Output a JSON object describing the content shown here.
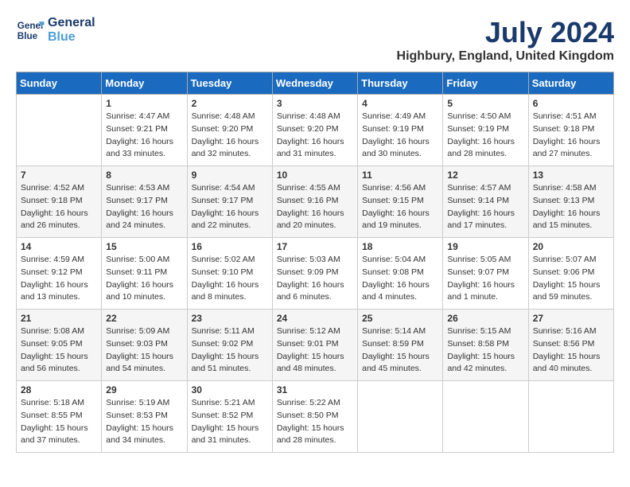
{
  "logo": {
    "line1": "General",
    "line2": "Blue"
  },
  "title": "July 2024",
  "location": "Highbury, England, United Kingdom",
  "days_of_week": [
    "Sunday",
    "Monday",
    "Tuesday",
    "Wednesday",
    "Thursday",
    "Friday",
    "Saturday"
  ],
  "weeks": [
    [
      {
        "day": "",
        "sunrise": "",
        "sunset": "",
        "daylight": ""
      },
      {
        "day": "1",
        "sunrise": "Sunrise: 4:47 AM",
        "sunset": "Sunset: 9:21 PM",
        "daylight": "Daylight: 16 hours and 33 minutes."
      },
      {
        "day": "2",
        "sunrise": "Sunrise: 4:48 AM",
        "sunset": "Sunset: 9:20 PM",
        "daylight": "Daylight: 16 hours and 32 minutes."
      },
      {
        "day": "3",
        "sunrise": "Sunrise: 4:48 AM",
        "sunset": "Sunset: 9:20 PM",
        "daylight": "Daylight: 16 hours and 31 minutes."
      },
      {
        "day": "4",
        "sunrise": "Sunrise: 4:49 AM",
        "sunset": "Sunset: 9:19 PM",
        "daylight": "Daylight: 16 hours and 30 minutes."
      },
      {
        "day": "5",
        "sunrise": "Sunrise: 4:50 AM",
        "sunset": "Sunset: 9:19 PM",
        "daylight": "Daylight: 16 hours and 28 minutes."
      },
      {
        "day": "6",
        "sunrise": "Sunrise: 4:51 AM",
        "sunset": "Sunset: 9:18 PM",
        "daylight": "Daylight: 16 hours and 27 minutes."
      }
    ],
    [
      {
        "day": "7",
        "sunrise": "Sunrise: 4:52 AM",
        "sunset": "Sunset: 9:18 PM",
        "daylight": "Daylight: 16 hours and 26 minutes."
      },
      {
        "day": "8",
        "sunrise": "Sunrise: 4:53 AM",
        "sunset": "Sunset: 9:17 PM",
        "daylight": "Daylight: 16 hours and 24 minutes."
      },
      {
        "day": "9",
        "sunrise": "Sunrise: 4:54 AM",
        "sunset": "Sunset: 9:17 PM",
        "daylight": "Daylight: 16 hours and 22 minutes."
      },
      {
        "day": "10",
        "sunrise": "Sunrise: 4:55 AM",
        "sunset": "Sunset: 9:16 PM",
        "daylight": "Daylight: 16 hours and 20 minutes."
      },
      {
        "day": "11",
        "sunrise": "Sunrise: 4:56 AM",
        "sunset": "Sunset: 9:15 PM",
        "daylight": "Daylight: 16 hours and 19 minutes."
      },
      {
        "day": "12",
        "sunrise": "Sunrise: 4:57 AM",
        "sunset": "Sunset: 9:14 PM",
        "daylight": "Daylight: 16 hours and 17 minutes."
      },
      {
        "day": "13",
        "sunrise": "Sunrise: 4:58 AM",
        "sunset": "Sunset: 9:13 PM",
        "daylight": "Daylight: 16 hours and 15 minutes."
      }
    ],
    [
      {
        "day": "14",
        "sunrise": "Sunrise: 4:59 AM",
        "sunset": "Sunset: 9:12 PM",
        "daylight": "Daylight: 16 hours and 13 minutes."
      },
      {
        "day": "15",
        "sunrise": "Sunrise: 5:00 AM",
        "sunset": "Sunset: 9:11 PM",
        "daylight": "Daylight: 16 hours and 10 minutes."
      },
      {
        "day": "16",
        "sunrise": "Sunrise: 5:02 AM",
        "sunset": "Sunset: 9:10 PM",
        "daylight": "Daylight: 16 hours and 8 minutes."
      },
      {
        "day": "17",
        "sunrise": "Sunrise: 5:03 AM",
        "sunset": "Sunset: 9:09 PM",
        "daylight": "Daylight: 16 hours and 6 minutes."
      },
      {
        "day": "18",
        "sunrise": "Sunrise: 5:04 AM",
        "sunset": "Sunset: 9:08 PM",
        "daylight": "Daylight: 16 hours and 4 minutes."
      },
      {
        "day": "19",
        "sunrise": "Sunrise: 5:05 AM",
        "sunset": "Sunset: 9:07 PM",
        "daylight": "Daylight: 16 hours and 1 minute."
      },
      {
        "day": "20",
        "sunrise": "Sunrise: 5:07 AM",
        "sunset": "Sunset: 9:06 PM",
        "daylight": "Daylight: 15 hours and 59 minutes."
      }
    ],
    [
      {
        "day": "21",
        "sunrise": "Sunrise: 5:08 AM",
        "sunset": "Sunset: 9:05 PM",
        "daylight": "Daylight: 15 hours and 56 minutes."
      },
      {
        "day": "22",
        "sunrise": "Sunrise: 5:09 AM",
        "sunset": "Sunset: 9:03 PM",
        "daylight": "Daylight: 15 hours and 54 minutes."
      },
      {
        "day": "23",
        "sunrise": "Sunrise: 5:11 AM",
        "sunset": "Sunset: 9:02 PM",
        "daylight": "Daylight: 15 hours and 51 minutes."
      },
      {
        "day": "24",
        "sunrise": "Sunrise: 5:12 AM",
        "sunset": "Sunset: 9:01 PM",
        "daylight": "Daylight: 15 hours and 48 minutes."
      },
      {
        "day": "25",
        "sunrise": "Sunrise: 5:14 AM",
        "sunset": "Sunset: 8:59 PM",
        "daylight": "Daylight: 15 hours and 45 minutes."
      },
      {
        "day": "26",
        "sunrise": "Sunrise: 5:15 AM",
        "sunset": "Sunset: 8:58 PM",
        "daylight": "Daylight: 15 hours and 42 minutes."
      },
      {
        "day": "27",
        "sunrise": "Sunrise: 5:16 AM",
        "sunset": "Sunset: 8:56 PM",
        "daylight": "Daylight: 15 hours and 40 minutes."
      }
    ],
    [
      {
        "day": "28",
        "sunrise": "Sunrise: 5:18 AM",
        "sunset": "Sunset: 8:55 PM",
        "daylight": "Daylight: 15 hours and 37 minutes."
      },
      {
        "day": "29",
        "sunrise": "Sunrise: 5:19 AM",
        "sunset": "Sunset: 8:53 PM",
        "daylight": "Daylight: 15 hours and 34 minutes."
      },
      {
        "day": "30",
        "sunrise": "Sunrise: 5:21 AM",
        "sunset": "Sunset: 8:52 PM",
        "daylight": "Daylight: 15 hours and 31 minutes."
      },
      {
        "day": "31",
        "sunrise": "Sunrise: 5:22 AM",
        "sunset": "Sunset: 8:50 PM",
        "daylight": "Daylight: 15 hours and 28 minutes."
      },
      {
        "day": "",
        "sunrise": "",
        "sunset": "",
        "daylight": ""
      },
      {
        "day": "",
        "sunrise": "",
        "sunset": "",
        "daylight": ""
      },
      {
        "day": "",
        "sunrise": "",
        "sunset": "",
        "daylight": ""
      }
    ]
  ]
}
